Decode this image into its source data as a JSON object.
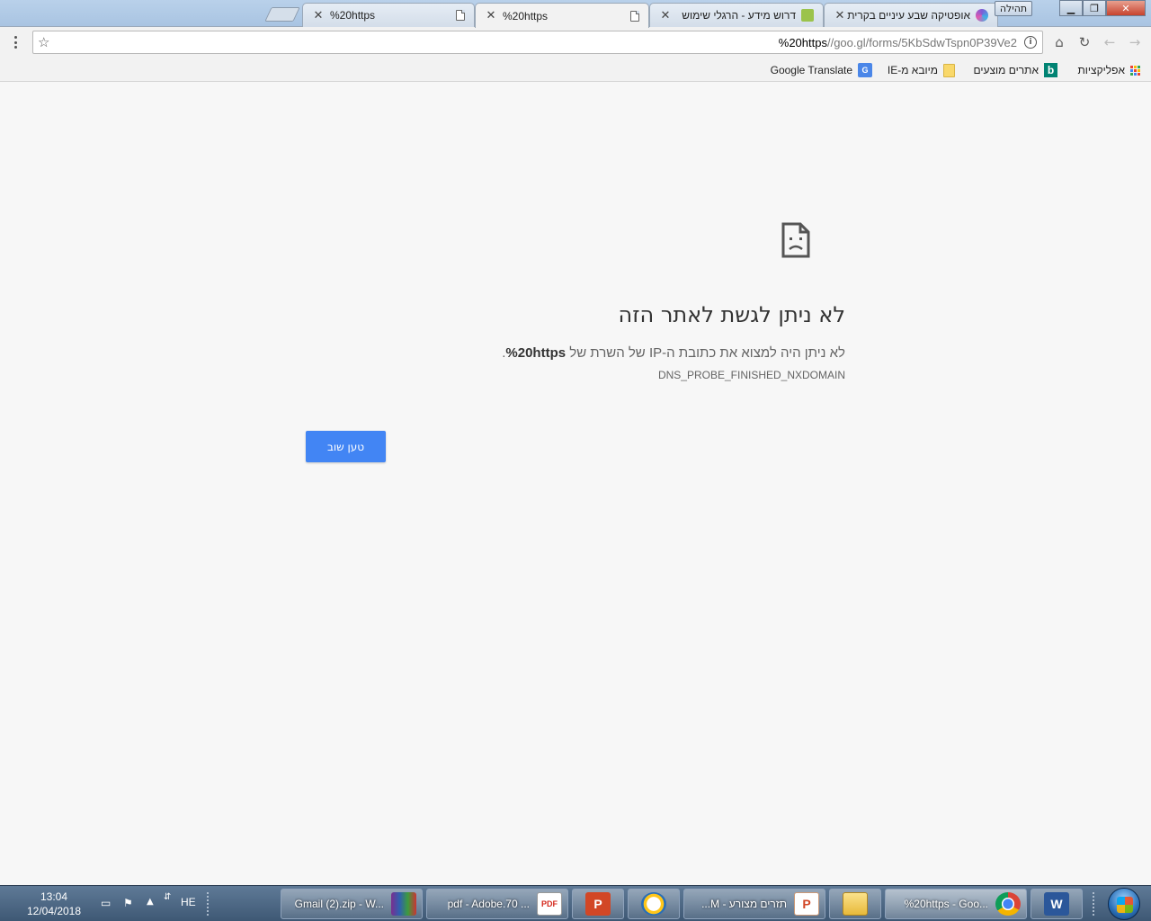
{
  "window": {
    "help_label": "תהילה",
    "minimize_glyph": "▁",
    "maximize_glyph": "❐",
    "close_glyph": "✕"
  },
  "tabs": [
    {
      "title": "%20https",
      "icon": "page-icon",
      "active": false
    },
    {
      "title": "%20https",
      "icon": "page-icon",
      "active": true
    },
    {
      "title": "דרוש מידע - הרגלי שימוש",
      "icon": "green-favicon",
      "active": false
    },
    {
      "title": "אופטיקה שבע עיניים בקרית",
      "icon": "butterfly-favicon",
      "active": false
    }
  ],
  "toolbar": {
    "url_host": "%20https",
    "url_rest": "//goo.gl/forms/5KbSdwTspn0P39Ve2",
    "back_glyph": "←",
    "forward_glyph": "→",
    "reload_glyph": "↻",
    "home_glyph": "⌂",
    "star_glyph": "☆",
    "info_glyph": "i"
  },
  "bookmarks": [
    {
      "label": "אפליקציות",
      "icon": "apps-grid-icon"
    },
    {
      "label": "אתרים מוצעים",
      "icon": "bing-icon"
    },
    {
      "label": "מיובא מ-IE",
      "icon": "folder-icon"
    },
    {
      "label": "Google Translate",
      "icon": "google-translate-icon"
    }
  ],
  "error": {
    "title": "לא ניתן לגשת לאתר הזה",
    "desc_prefix": "לא ניתן היה למצוא את כתובת ה-IP של השרת של ",
    "desc_host": "%20https",
    "desc_suffix": ".",
    "code": "DNS_PROBE_FINISHED_NXDOMAIN",
    "reload_label": "טען שוב"
  },
  "taskbar": {
    "time": "13:04",
    "date": "12/04/2018",
    "lang": "HE",
    "items": [
      {
        "label": "Gmail (2).zip - W...",
        "icon": "winrar-icon"
      },
      {
        "label": "pdf - Adobe.70 ...",
        "icon": "pdf-icon"
      },
      {
        "label": "",
        "icon": "powerpoint-icon"
      },
      {
        "label": "",
        "icon": "clock-app-icon"
      },
      {
        "label": "תזרים מצורע - M...",
        "icon": "powerpoint-doc-icon"
      },
      {
        "label": "",
        "icon": "explorer-icon"
      },
      {
        "label": "%20https - Goo...",
        "icon": "chrome-icon"
      },
      {
        "label": "",
        "icon": "word-icon"
      }
    ]
  },
  "colors": {
    "accent": "#4285f4",
    "page_bg": "#f7f7f7"
  }
}
